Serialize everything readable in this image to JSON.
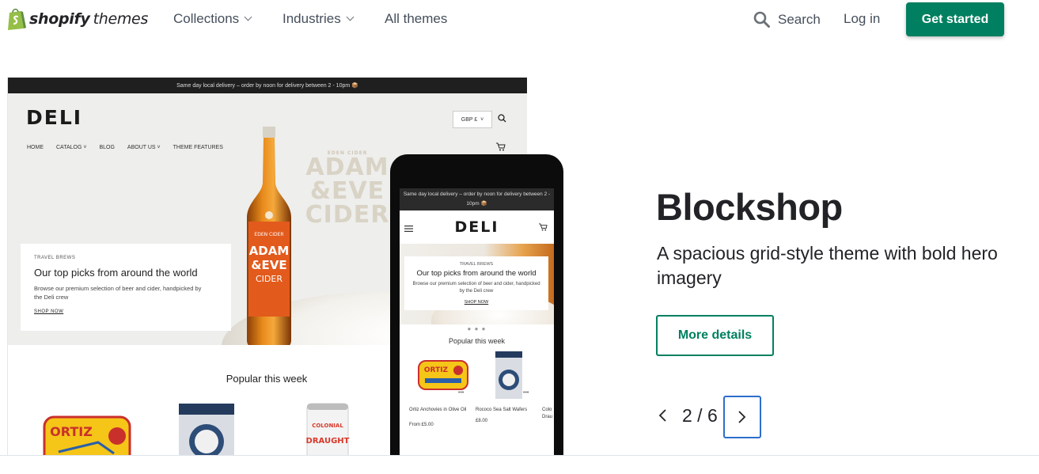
{
  "nav": {
    "brand": "shopify",
    "brand_sub": "themes",
    "collections": "Collections",
    "industries": "Industries",
    "all_themes": "All themes",
    "search": "Search",
    "login": "Log in",
    "get_started": "Get started",
    "accent": "#008060"
  },
  "preview": {
    "announcement": "Same day local delivery – order by noon for delivery between 2 - 10pm 📦",
    "store_logo": "DELI",
    "menu": [
      "HOME",
      "CATALOG",
      "BLOG",
      "ABOUT US",
      "THEME FEATURES"
    ],
    "currency": "GBP £",
    "bottle_label": [
      "EDEN CIDER",
      "ADAM",
      "&EVE",
      "CIDER"
    ],
    "ghost_small": "EDEN CIDER",
    "ghost_big": [
      "ADAM",
      "&EVE",
      "CIDER"
    ],
    "card": {
      "eyebrow": "TRAVEL BREWS",
      "title": "Our top picks from around the world",
      "body": "Browse our premium selection of beer and cider, handpicked by the Deli crew",
      "link": "SHOP NOW"
    },
    "popular": "Popular this week",
    "products": [
      "ORTIZ",
      "COLONIAL DRAUGHT"
    ]
  },
  "mobile": {
    "announcement": "Same day local delivery – order by noon for delivery between 2 - 10pm 📦",
    "store_logo": "DELI",
    "card": {
      "eyebrow": "TRAVEL BREWS",
      "title": "Our top picks from around the world",
      "body": "Browse our premium selection of beer and cider, handpicked by the Deli crew",
      "link": "SHOP NOW"
    },
    "popular": "Popular this week",
    "products": [
      {
        "name": "Ortiz Anchovies in Olive Oil",
        "price": "From £5.00"
      },
      {
        "name": "Rococo Sea Salt Wafers",
        "price": "£8.00"
      },
      {
        "name": "Colo Drau",
        "price": ""
      }
    ]
  },
  "theme": {
    "title": "Blockshop",
    "description": "A spacious grid-style theme with bold hero imagery",
    "more_details": "More details",
    "pager": "2 / 6"
  }
}
